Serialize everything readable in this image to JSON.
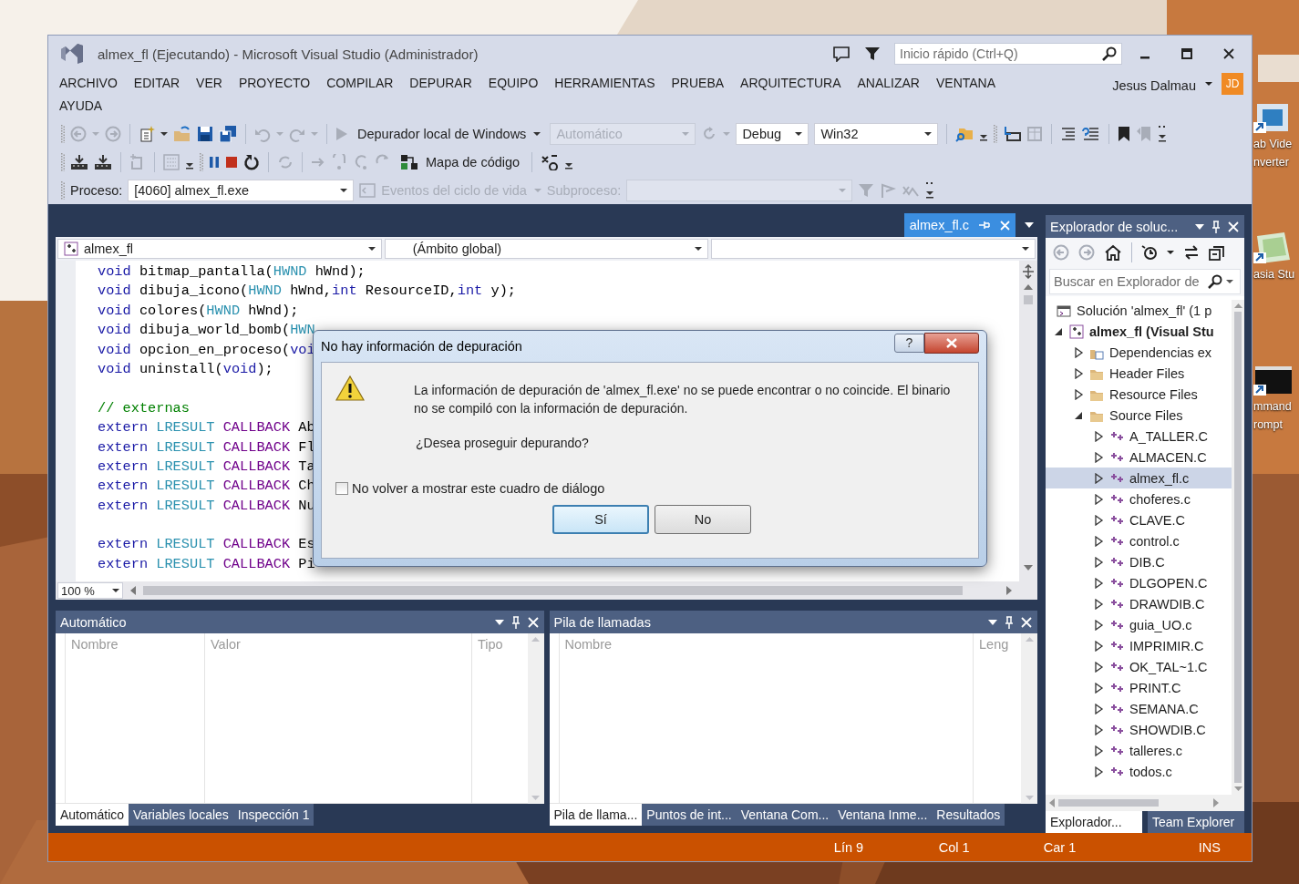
{
  "window": {
    "title": "almex_fl (Ejecutando) - Microsoft Visual Studio (Administrador)"
  },
  "quick_launch": {
    "placeholder": "Inicio rápido (Ctrl+Q)"
  },
  "menu": [
    "ARCHIVO",
    "EDITAR",
    "VER",
    "PROYECTO",
    "COMPILAR",
    "DEPURAR",
    "EQUIPO",
    "HERRAMIENTAS",
    "PRUEBA",
    "ARQUITECTURA",
    "ANALIZAR",
    "VENTANA",
    "AYUDA"
  ],
  "user": {
    "name": "Jesus Dalmau",
    "initials": "JD"
  },
  "toolbar": {
    "debugger": "Depurador local de Windows",
    "solution_config": {
      "value": "Automático",
      "disabled": true
    },
    "configuration": {
      "value": "Debug",
      "disabled": false
    },
    "platform": {
      "value": "Win32",
      "disabled": false
    },
    "code_map": "Mapa de código",
    "process_label": "Proceso:",
    "process": {
      "value": "[4060] almex_fl.exe",
      "disabled": false
    },
    "lifecycle_events": {
      "label": "Eventos del ciclo de vida",
      "disabled": true
    },
    "thread_label": {
      "text": "Subproceso:",
      "disabled": true
    },
    "thread": {
      "disabled": true
    }
  },
  "document_tab": {
    "label": "almex_fl.c",
    "selected": true
  },
  "editor": {
    "navigation": [
      "almex_fl",
      "(Ámbito global)"
    ],
    "code_lines": [
      {
        "tokens": [
          {
            "text": "void",
            "kind": "keyword"
          },
          {
            "text": " bitmap_pantalla(",
            "kind": "plain"
          },
          {
            "text": "HWND",
            "kind": "type"
          },
          {
            "text": " hWnd);",
            "kind": "plain"
          }
        ]
      },
      {
        "tokens": [
          {
            "text": "void",
            "kind": "keyword"
          },
          {
            "text": " dibuja_icono(",
            "kind": "plain"
          },
          {
            "text": "HWND",
            "kind": "type"
          },
          {
            "text": " hWnd,",
            "kind": "plain"
          },
          {
            "text": "int",
            "kind": "keyword"
          },
          {
            "text": " ResourceID,",
            "kind": "plain"
          },
          {
            "text": "int",
            "kind": "keyword"
          },
          {
            "text": " y);",
            "kind": "plain"
          }
        ]
      },
      {
        "tokens": [
          {
            "text": "void",
            "kind": "keyword"
          },
          {
            "text": " colores(",
            "kind": "plain"
          },
          {
            "text": "HWND",
            "kind": "type"
          },
          {
            "text": " hWnd);",
            "kind": "plain"
          }
        ]
      },
      {
        "tokens": [
          {
            "text": "void",
            "kind": "keyword"
          },
          {
            "text": " dibuja_world_bomb(",
            "kind": "plain"
          },
          {
            "text": "HWN",
            "kind": "type"
          }
        ]
      },
      {
        "tokens": [
          {
            "text": "void",
            "kind": "keyword"
          },
          {
            "text": " opcion_en_proceso(",
            "kind": "plain"
          },
          {
            "text": "voi",
            "kind": "keyword"
          }
        ]
      },
      {
        "tokens": [
          {
            "text": "void",
            "kind": "keyword"
          },
          {
            "text": " uninstall(",
            "kind": "plain"
          },
          {
            "text": "void",
            "kind": "keyword"
          },
          {
            "text": ");",
            "kind": "plain"
          }
        ]
      },
      {
        "after_blank": true,
        "tokens": [
          {
            "text": "// externas",
            "kind": "comment"
          }
        ]
      },
      {
        "tokens": [
          {
            "text": "extern",
            "kind": "keyword"
          },
          {
            "text": " LRESULT",
            "kind": "type"
          },
          {
            "text": " CALLBACK",
            "kind": "macro"
          },
          {
            "text": " Ab",
            "kind": "plain"
          }
        ]
      },
      {
        "tokens": [
          {
            "text": "extern",
            "kind": "keyword"
          },
          {
            "text": " LRESULT",
            "kind": "type"
          },
          {
            "text": " CALLBACK",
            "kind": "macro"
          },
          {
            "text": " Fl",
            "kind": "plain"
          }
        ]
      },
      {
        "tokens": [
          {
            "text": "extern",
            "kind": "keyword"
          },
          {
            "text": " LRESULT",
            "kind": "type"
          },
          {
            "text": " CALLBACK",
            "kind": "macro"
          },
          {
            "text": " Ta",
            "kind": "plain"
          }
        ]
      },
      {
        "tokens": [
          {
            "text": "extern",
            "kind": "keyword"
          },
          {
            "text": " LRESULT",
            "kind": "type"
          },
          {
            "text": " CALLBACK",
            "kind": "macro"
          },
          {
            "text": " Ch",
            "kind": "plain"
          }
        ]
      },
      {
        "tokens": [
          {
            "text": "extern",
            "kind": "keyword"
          },
          {
            "text": " LRESULT",
            "kind": "type"
          },
          {
            "text": " CALLBACK",
            "kind": "macro"
          },
          {
            "text": " Nu",
            "kind": "plain"
          }
        ]
      },
      {
        "after_blank": true,
        "tokens": [
          {
            "text": "extern",
            "kind": "keyword"
          },
          {
            "text": " LRESULT",
            "kind": "type"
          },
          {
            "text": " CALLBACK",
            "kind": "macro"
          },
          {
            "text": " Es",
            "kind": "plain"
          }
        ]
      },
      {
        "tokens": [
          {
            "text": "extern",
            "kind": "keyword"
          },
          {
            "text": " LRESULT",
            "kind": "type"
          },
          {
            "text": " CALLBACK",
            "kind": "macro"
          },
          {
            "text": " Pi",
            "kind": "plain"
          }
        ]
      }
    ],
    "zoom": "100 %"
  },
  "dialog": {
    "title": "No hay información de depuración",
    "help": "?",
    "message": "La información de depuración de 'almex_fl.exe' no se puede encontrar o no coincide. El binario no se compiló con la información de depuración.",
    "question": "¿Desea proseguir depurando?",
    "checkbox": {
      "label": "No volver a mostrar este cuadro de diálogo",
      "checked": false
    },
    "buttons": [
      {
        "label": "Sí",
        "default": true
      },
      {
        "label": "No",
        "default": false
      }
    ]
  },
  "autos_panel": {
    "title": "Automático",
    "columns": [
      "Nombre",
      "Valor",
      "Tipo"
    ],
    "tabs": [
      {
        "label": "Automático",
        "selected": true
      },
      {
        "label": "Variables locales",
        "selected": false
      },
      {
        "label": "Inspección 1",
        "selected": false
      }
    ]
  },
  "call_stack_panel": {
    "title": "Pila de llamadas",
    "columns": [
      "Nombre",
      "Leng"
    ],
    "tabs": [
      {
        "label": "Pila de llama...",
        "selected": true
      },
      {
        "label": "Puntos de int...",
        "selected": false
      },
      {
        "label": "Ventana Com...",
        "selected": false
      },
      {
        "label": "Ventana Inme...",
        "selected": false
      },
      {
        "label": "Resultados",
        "selected": false
      }
    ]
  },
  "solution_explorer": {
    "title": "Explorador de soluc...",
    "search": {
      "placeholder": "Buscar en Explorador de"
    },
    "tree": [
      {
        "label": "Solución 'almex_fl'  (1 p",
        "kind": "solution",
        "selected": false,
        "children": [
          {
            "label": "almex_fl (Visual Stu",
            "kind": "project",
            "expanded": true,
            "selected": false,
            "children": [
              {
                "label": "Dependencias ex",
                "kind": "dependencies",
                "expanded": false,
                "selected": false
              },
              {
                "label": "Header Files",
                "kind": "folder",
                "expanded": false,
                "selected": false
              },
              {
                "label": "Resource Files",
                "kind": "folder",
                "expanded": false,
                "selected": false
              },
              {
                "label": "Source Files",
                "kind": "folder",
                "expanded": true,
                "selected": false,
                "children": [
                  {
                    "label": "A_TALLER.C",
                    "kind": "file",
                    "expanded": false,
                    "selected": false
                  },
                  {
                    "label": "ALMACEN.C",
                    "kind": "file",
                    "expanded": false,
                    "selected": false
                  },
                  {
                    "label": "almex_fl.c",
                    "kind": "file",
                    "expanded": false,
                    "selected": true
                  },
                  {
                    "label": "choferes.c",
                    "kind": "file",
                    "expanded": false,
                    "selected": false
                  },
                  {
                    "label": "CLAVE.C",
                    "kind": "file",
                    "expanded": false,
                    "selected": false
                  },
                  {
                    "label": "control.c",
                    "kind": "file",
                    "expanded": false,
                    "selected": false
                  },
                  {
                    "label": "DIB.C",
                    "kind": "file",
                    "expanded": false,
                    "selected": false
                  },
                  {
                    "label": "DLGOPEN.C",
                    "kind": "file",
                    "expanded": false,
                    "selected": false
                  },
                  {
                    "label": "DRAWDIB.C",
                    "kind": "file",
                    "expanded": false,
                    "selected": false
                  },
                  {
                    "label": "guia_UO.c",
                    "kind": "file",
                    "expanded": false,
                    "selected": false
                  },
                  {
                    "label": "IMPRIMIR.C",
                    "kind": "file",
                    "expanded": false,
                    "selected": false
                  },
                  {
                    "label": "OK_TAL~1.C",
                    "kind": "file",
                    "expanded": false,
                    "selected": false
                  },
                  {
                    "label": "PRINT.C",
                    "kind": "file",
                    "expanded": false,
                    "selected": false
                  },
                  {
                    "label": "SEMANA.C",
                    "kind": "file",
                    "expanded": false,
                    "selected": false
                  },
                  {
                    "label": "SHOWDIB.C",
                    "kind": "file",
                    "expanded": false,
                    "selected": false
                  },
                  {
                    "label": "talleres.c",
                    "kind": "file",
                    "expanded": false,
                    "selected": false
                  },
                  {
                    "label": "todos.c",
                    "kind": "file",
                    "expanded": false,
                    "selected": false
                  }
                ]
              }
            ]
          }
        ]
      }
    ],
    "tabs": [
      {
        "label": "Explorador...",
        "selected": true
      },
      {
        "label": "Team Explorer",
        "selected": false
      }
    ]
  },
  "status_bar": {
    "line": "Lín 9",
    "column": "Col 1",
    "character": "Car 1",
    "mode": "INS"
  },
  "desktop_icons": [
    {
      "kind": "media",
      "lines": [
        "ab Vide",
        "nverter"
      ]
    },
    {
      "kind": "paper",
      "lines": [
        "asia Stu"
      ]
    },
    {
      "kind": "console",
      "lines": [
        "mmand",
        "rompt"
      ]
    }
  ]
}
